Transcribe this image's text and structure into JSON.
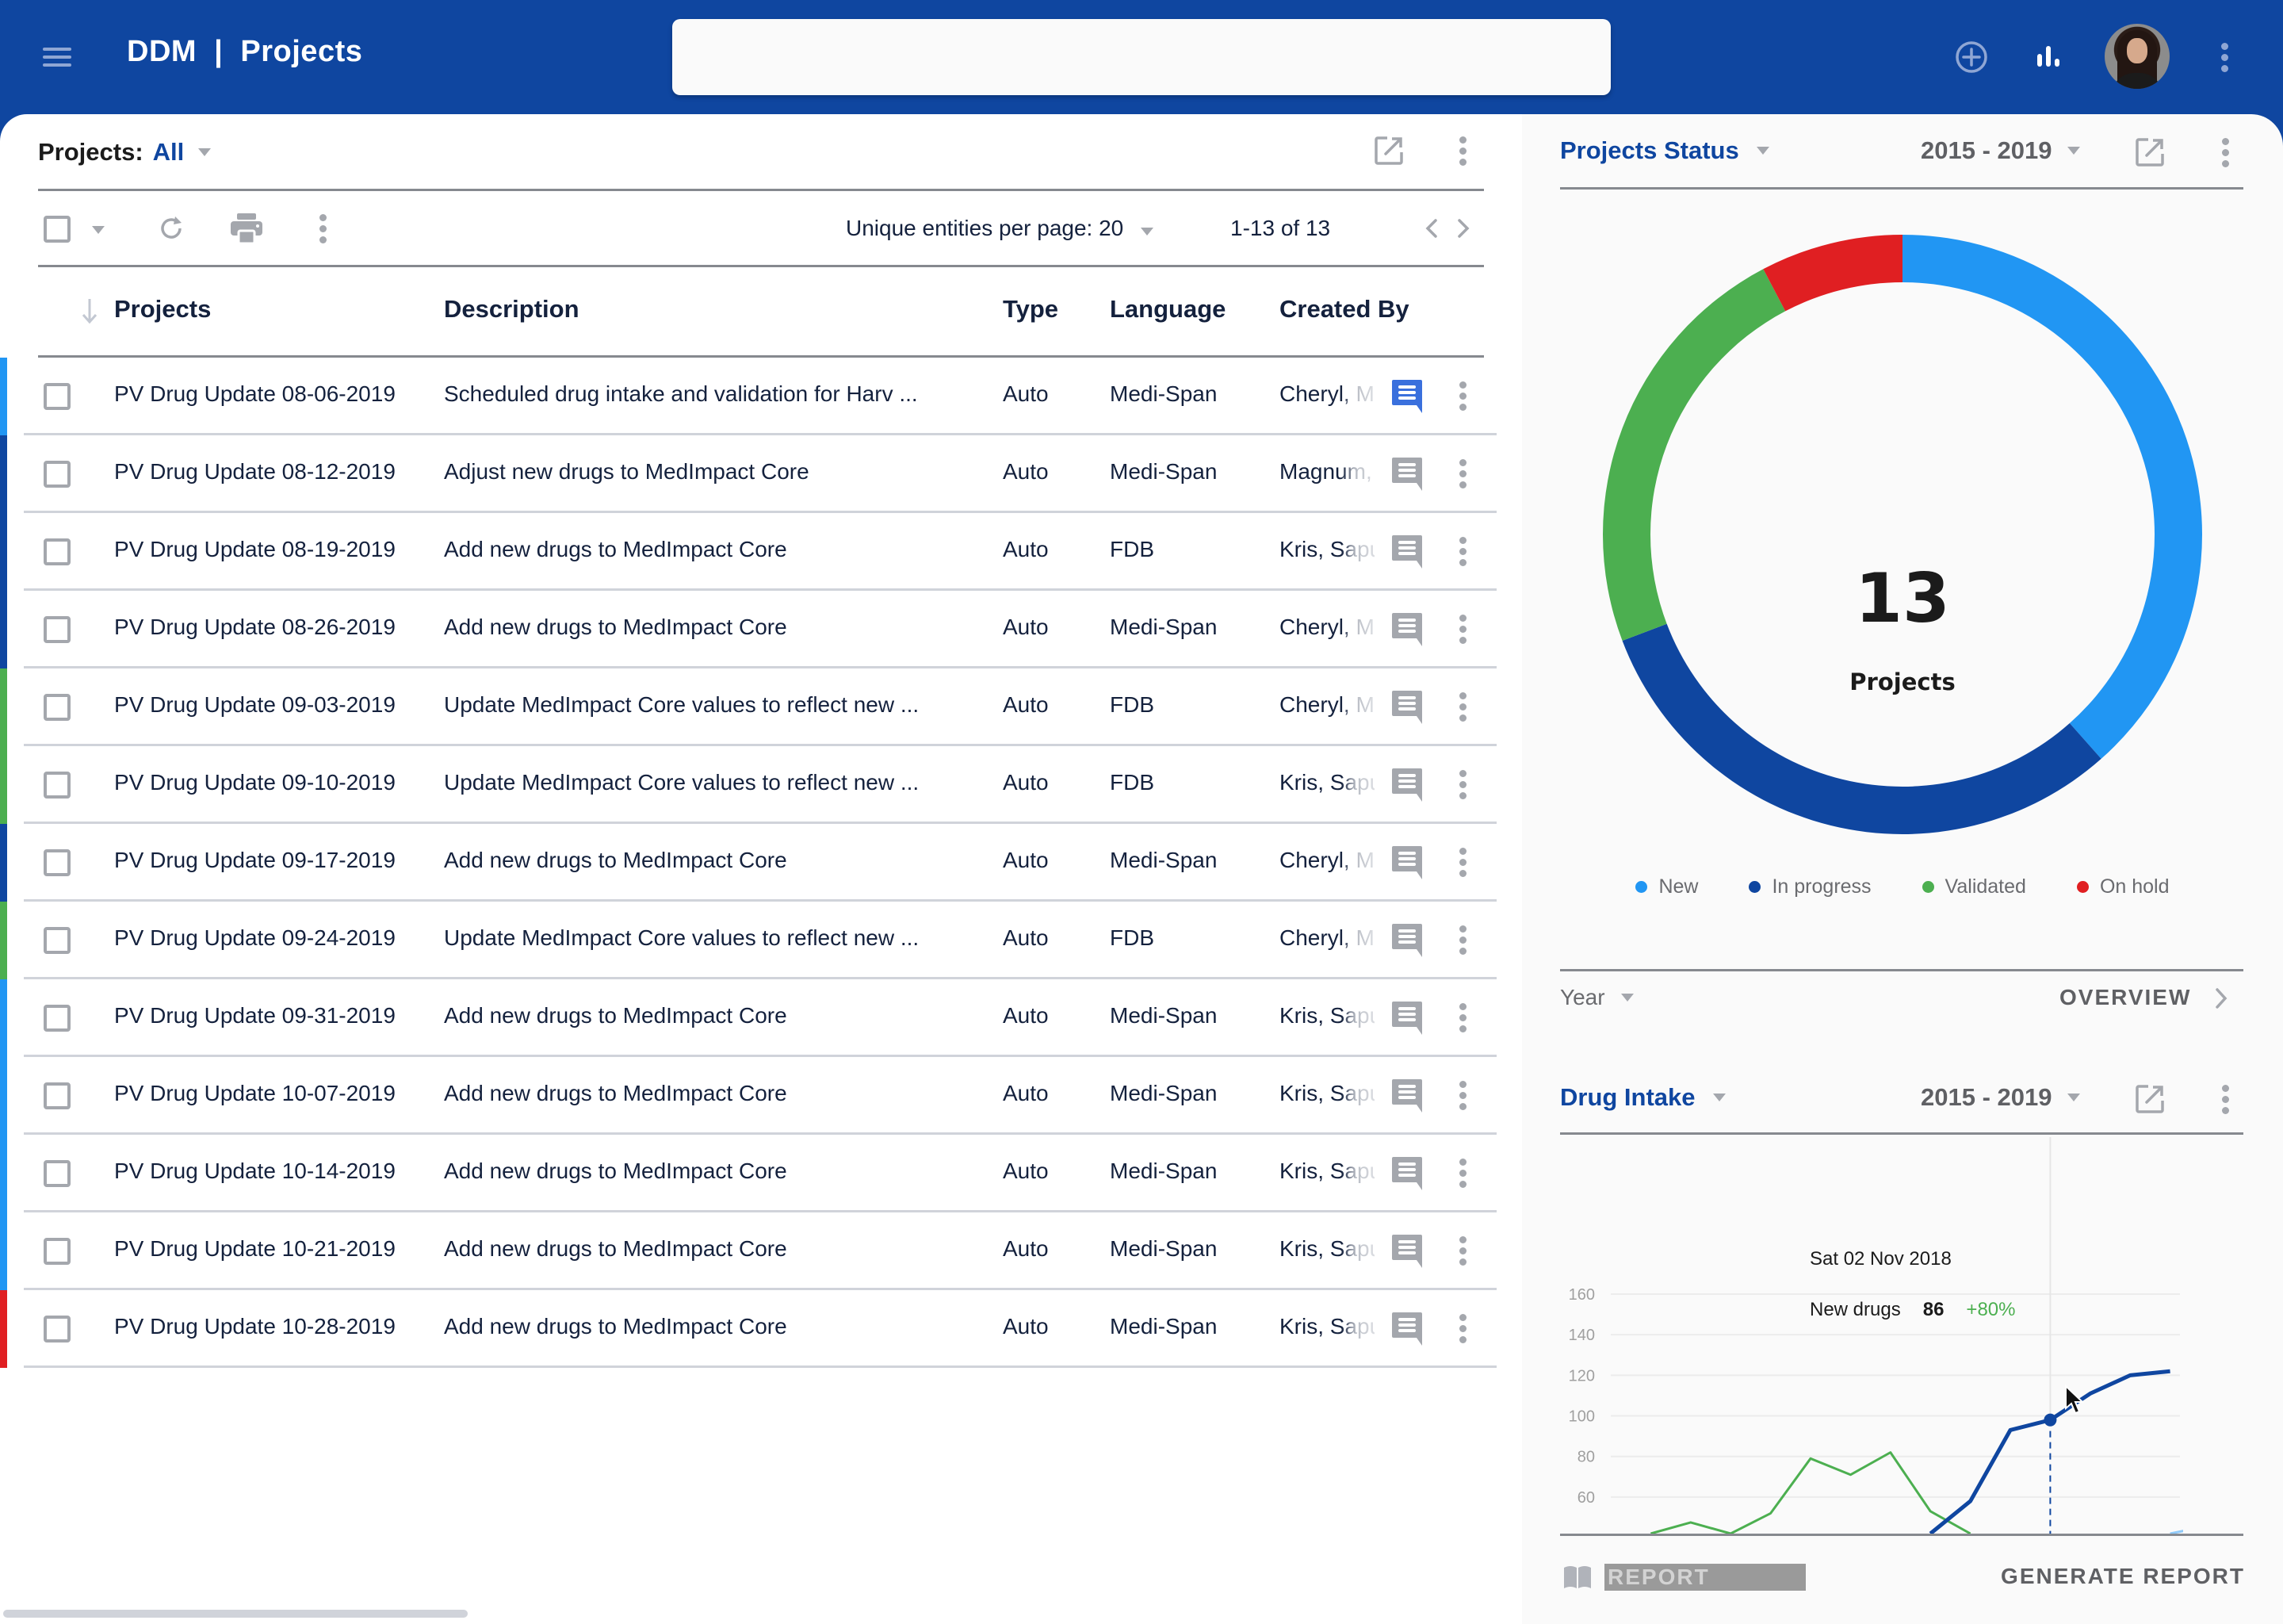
{
  "header": {
    "menu_icon": "hamburger-menu-icon",
    "title": "DDM  |  Projects",
    "search": {
      "value": "",
      "placeholder": ""
    },
    "icons": [
      "add-circle-icon",
      "bar-chart-icon",
      "avatar",
      "more-vert-icon"
    ]
  },
  "projects_panel": {
    "filter_label": "Projects:",
    "filter_value": "All",
    "toolbar": {
      "per_page_label": "Unique entities per page: 20",
      "per_page_value": "20",
      "range": "1-13 of 13"
    },
    "columns": [
      "Projects",
      "Description",
      "Type",
      "Language",
      "Created By"
    ],
    "rows": [
      {
        "status": "new",
        "project": "PV Drug Update  08-06-2019",
        "description": "Scheduled drug intake and validation for Harv ...",
        "type": "Auto",
        "language": "Medi-Span",
        "created_by": "Cheryl, M",
        "comment_active": true
      },
      {
        "status": "in_progress",
        "project": "PV Drug Update  08-12-2019",
        "description": "Adjust new drugs to MedImpact Core",
        "type": "Auto",
        "language": "Medi-Span",
        "created_by": "Magnum,",
        "comment_active": false
      },
      {
        "status": "in_progress",
        "project": "PV Drug Update  08-19-2019",
        "description": "Add new drugs to MedImpact Core",
        "type": "Auto",
        "language": "FDB",
        "created_by": "Kris, Sapu",
        "comment_active": false
      },
      {
        "status": "in_progress",
        "project": "PV Drug Update  08-26-2019",
        "description": "Add new drugs to MedImpact Core",
        "type": "Auto",
        "language": "Medi-Span",
        "created_by": "Cheryl, M",
        "comment_active": false
      },
      {
        "status": "validated",
        "project": "PV Drug Update  09-03-2019",
        "description": "Update MedImpact Core values to reflect new ...",
        "type": "Auto",
        "language": "FDB",
        "created_by": "Cheryl, M",
        "comment_active": false
      },
      {
        "status": "validated",
        "project": "PV Drug Update  09-10-2019",
        "description": "Update MedImpact Core values to reflect new ...",
        "type": "Auto",
        "language": "FDB",
        "created_by": "Kris, Sapu",
        "comment_active": false
      },
      {
        "status": "in_progress",
        "project": "PV Drug Update  09-17-2019",
        "description": "Add new drugs to MedImpact Core",
        "type": "Auto",
        "language": "Medi-Span",
        "created_by": "Cheryl, M",
        "comment_active": false
      },
      {
        "status": "validated",
        "project": "PV Drug Update  09-24-2019",
        "description": "Update MedImpact Core values to reflect new ...",
        "type": "Auto",
        "language": "FDB",
        "created_by": "Cheryl, M",
        "comment_active": false
      },
      {
        "status": "new",
        "project": "PV Drug Update  09-31-2019",
        "description": "Add new drugs to MedImpact Core",
        "type": "Auto",
        "language": "Medi-Span",
        "created_by": "Kris, Sapu",
        "comment_active": false
      },
      {
        "status": "new",
        "project": "PV Drug Update  10-07-2019",
        "description": "Add new drugs to MedImpact Core",
        "type": "Auto",
        "language": "Medi-Span",
        "created_by": "Kris, Sapu",
        "comment_active": false
      },
      {
        "status": "new",
        "project": "PV Drug Update  10-14-2019",
        "description": "Add new drugs to MedImpact Core",
        "type": "Auto",
        "language": "Medi-Span",
        "created_by": "Kris, Sapu",
        "comment_active": false
      },
      {
        "status": "new",
        "project": "PV Drug Update  10-21-2019",
        "description": "Add new drugs to MedImpact Core",
        "type": "Auto",
        "language": "Medi-Span",
        "created_by": "Kris, Sapu",
        "comment_active": false
      },
      {
        "status": "on_hold",
        "project": "PV Drug Update  10-28-2019",
        "description": "Add new drugs to MedImpact Core",
        "type": "Auto",
        "language": "Medi-Span",
        "created_by": "Kris, Sapu",
        "comment_active": false
      }
    ]
  },
  "status_colors": {
    "new": "#2196f3",
    "in_progress": "#0f46a0",
    "validated": "#4caf50",
    "on_hold": "#e01f22"
  },
  "projects_status": {
    "title": "Projects Status",
    "range": "2015 - 2019",
    "total": "13",
    "total_label": "Projects",
    "year_selector": "Year",
    "overview_label": "OVERVIEW"
  },
  "drug_intake": {
    "title": "Drug Intake",
    "range": "2015 - 2019",
    "tooltip": {
      "date": "Sat 02 Nov 2018",
      "series": "New drugs",
      "value": "86",
      "change": "+80%"
    }
  },
  "footer": {
    "report_label": "REPORT",
    "generate_label": "GENERATE REPORT"
  },
  "chart_data": [
    {
      "type": "pie",
      "title": "Projects Status",
      "subtitle": "2015 - 2019",
      "center_value": 13,
      "center_label": "Projects",
      "categories": [
        "New",
        "In progress",
        "Validated",
        "On hold"
      ],
      "values": [
        5,
        4,
        3,
        1
      ],
      "colors": [
        "#2196f3",
        "#0f46a0",
        "#4caf50",
        "#e01f22"
      ],
      "legend": "bottom"
    },
    {
      "type": "line",
      "title": "Drug Intake",
      "subtitle": "2015 - 2019",
      "xlabel": "",
      "ylabel": "",
      "ylim": [
        42,
        160
      ],
      "y_ticks": [
        60,
        80,
        100,
        120,
        140,
        160
      ],
      "grid": true,
      "x": [
        0,
        1,
        2,
        3,
        4,
        5,
        6,
        7,
        8,
        9,
        10,
        11,
        12,
        13,
        14,
        15
      ],
      "series": [
        {
          "name": "Validated",
          "color": "#4caf50",
          "values": [
            null,
            42,
            47.5,
            42,
            52,
            79,
            71,
            82,
            53,
            42,
            null,
            null,
            null,
            null,
            null,
            null
          ]
        },
        {
          "name": "New drugs",
          "color": "#0f46a0",
          "values": [
            null,
            null,
            null,
            null,
            null,
            null,
            null,
            null,
            42,
            58,
            93,
            98,
            111,
            120,
            122,
            null
          ]
        },
        {
          "name": "New",
          "color": "#90caf9",
          "values": [
            null,
            null,
            null,
            null,
            null,
            null,
            null,
            null,
            null,
            null,
            null,
            null,
            null,
            null,
            42,
            46
          ]
        }
      ],
      "highlight": {
        "series": "New drugs",
        "index": 11,
        "date": "Sat 02 Nov 2018",
        "label": "New drugs",
        "value": 86,
        "change": "+80%"
      }
    }
  ]
}
